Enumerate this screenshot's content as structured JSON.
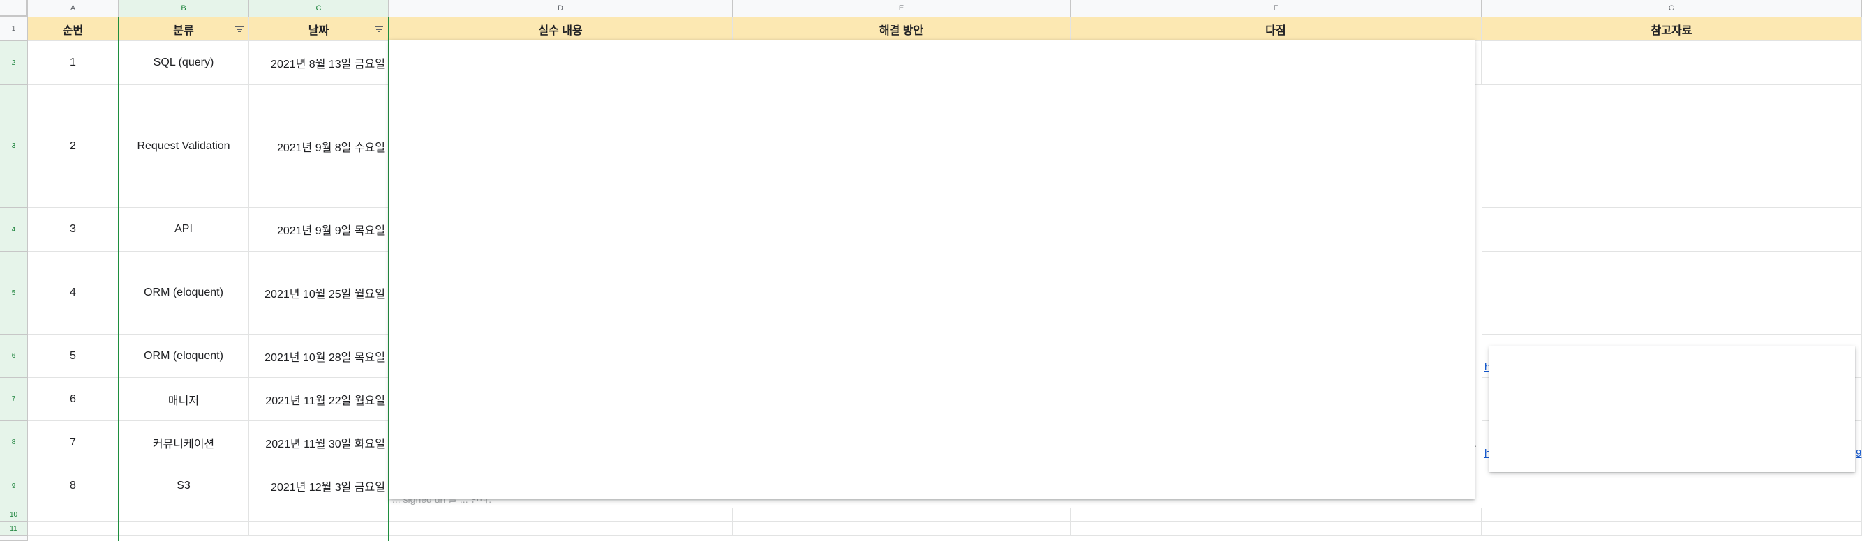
{
  "columns": [
    "A",
    "B",
    "C",
    "D",
    "E",
    "F",
    "G"
  ],
  "rows": [
    "1",
    "2",
    "3",
    "4",
    "5",
    "6",
    "7",
    "8",
    "9",
    "10",
    "11"
  ],
  "headers": {
    "no": "순번",
    "category": "분류",
    "date": "날짜",
    "mistake": "실수 내용",
    "solution": "해결 방안",
    "resolution": "다짐",
    "reference": "참고자료"
  },
  "records": [
    {
      "no": "1",
      "category": "SQL (query)",
      "date": "2021년 8월 13일 금요일"
    },
    {
      "no": "2",
      "category": "Request Validation",
      "date": "2021년 9월 8일 수요일"
    },
    {
      "no": "3",
      "category": "API",
      "date": "2021년 9월 9일 목요일"
    },
    {
      "no": "4",
      "category": "ORM (eloquent)",
      "date": "2021년 10월 25일 월요일"
    },
    {
      "no": "5",
      "category": "ORM (eloquent)",
      "date": "2021년 10월 28일 목요일"
    },
    {
      "no": "6",
      "category": "매니저",
      "date": "2021년 11월 22일 월요일"
    },
    {
      "no": "7",
      "category": "커뮤니케이션",
      "date": "2021년 11월 30일 화요일"
    },
    {
      "no": "8",
      "category": "S3",
      "date": "2021년 12월 3일 금요일"
    }
  ],
  "partial_text": {
    "link_start": "h",
    "link_end": "9",
    "trailing_dot": ".",
    "row9_overflow": "... signed url 을 ... 한다."
  },
  "colors": {
    "header_fill": "#fce8b2",
    "selection": "#1e8e3e",
    "selected_header": "#e6f4ea",
    "link": "#1155cc"
  }
}
